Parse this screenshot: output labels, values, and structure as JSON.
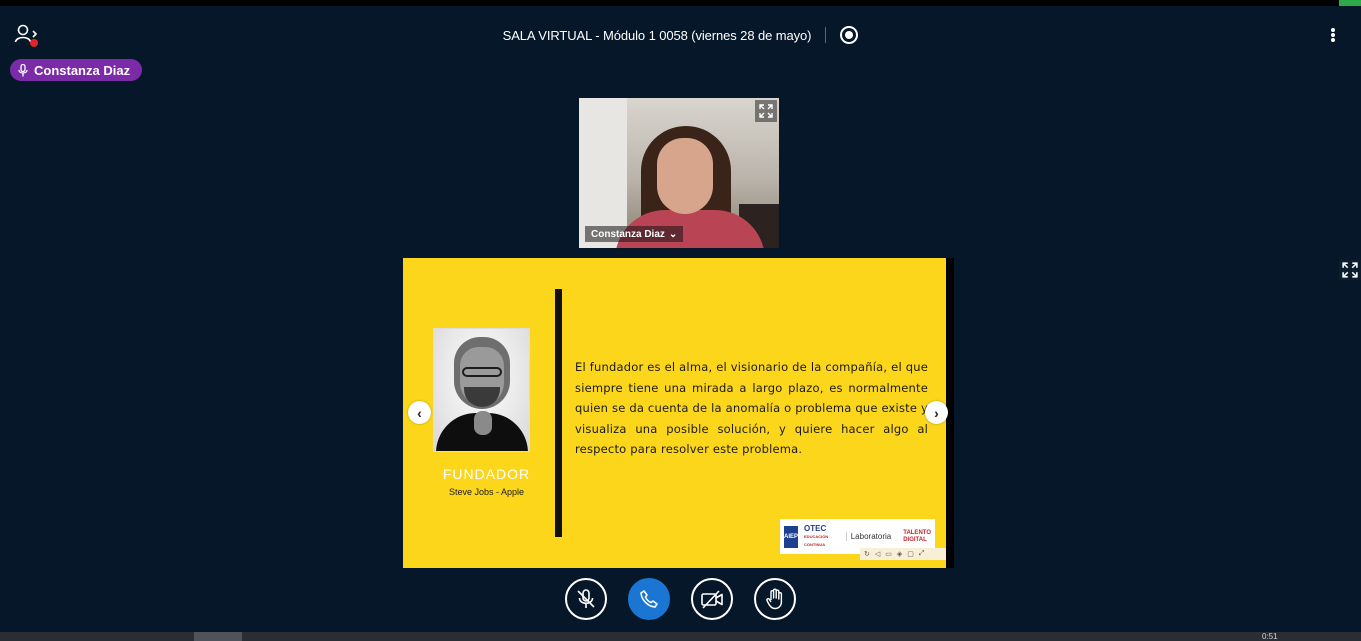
{
  "header": {
    "title": "SALA VIRTUAL - Módulo 1 0058 (viernes 28 de mayo)"
  },
  "talking_indicator": {
    "name": "Constanza Diaz"
  },
  "webcam": {
    "name": "Constanza Diaz",
    "name_chevron": "⌄"
  },
  "presentation": {
    "role_title": "FUNDADOR",
    "role_subtitle": "Steve Jobs - Apple",
    "quote": "El fundador es el alma, el visionario de la compañía, el que siempre tiene una mirada a largo plazo, es normalmente quien se da cuenta de la anomalía o problema que existe y visualiza una posible solución, y quiere hacer algo al respecto para resolver este problema.",
    "logos": {
      "aiep": "AIEP",
      "otec": "OTEC",
      "otec_sub": "EDUCACIÓN CONTINUA",
      "laboratoria": "Laboratoria",
      "talento": "TALENTO",
      "digital": "DIGITAL"
    },
    "prev_glyph": "‹",
    "next_glyph": "›"
  },
  "taskbar": {
    "clock": "0:51"
  },
  "colors": {
    "background": "#06172a",
    "talker_badge": "#7b2aa8",
    "slide_yellow": "#fcd61a",
    "phone_button": "#1a76d2",
    "alert_dot": "#e0252b"
  },
  "icons": {
    "users": "users-icon",
    "record": "record-icon",
    "options": "kebab-icon",
    "mic": "microphone-icon",
    "mute": "microphone-muted-icon",
    "phone": "phone-icon",
    "camera_off": "camera-off-icon",
    "raise_hand": "raise-hand-icon",
    "expand": "expand-icon"
  }
}
